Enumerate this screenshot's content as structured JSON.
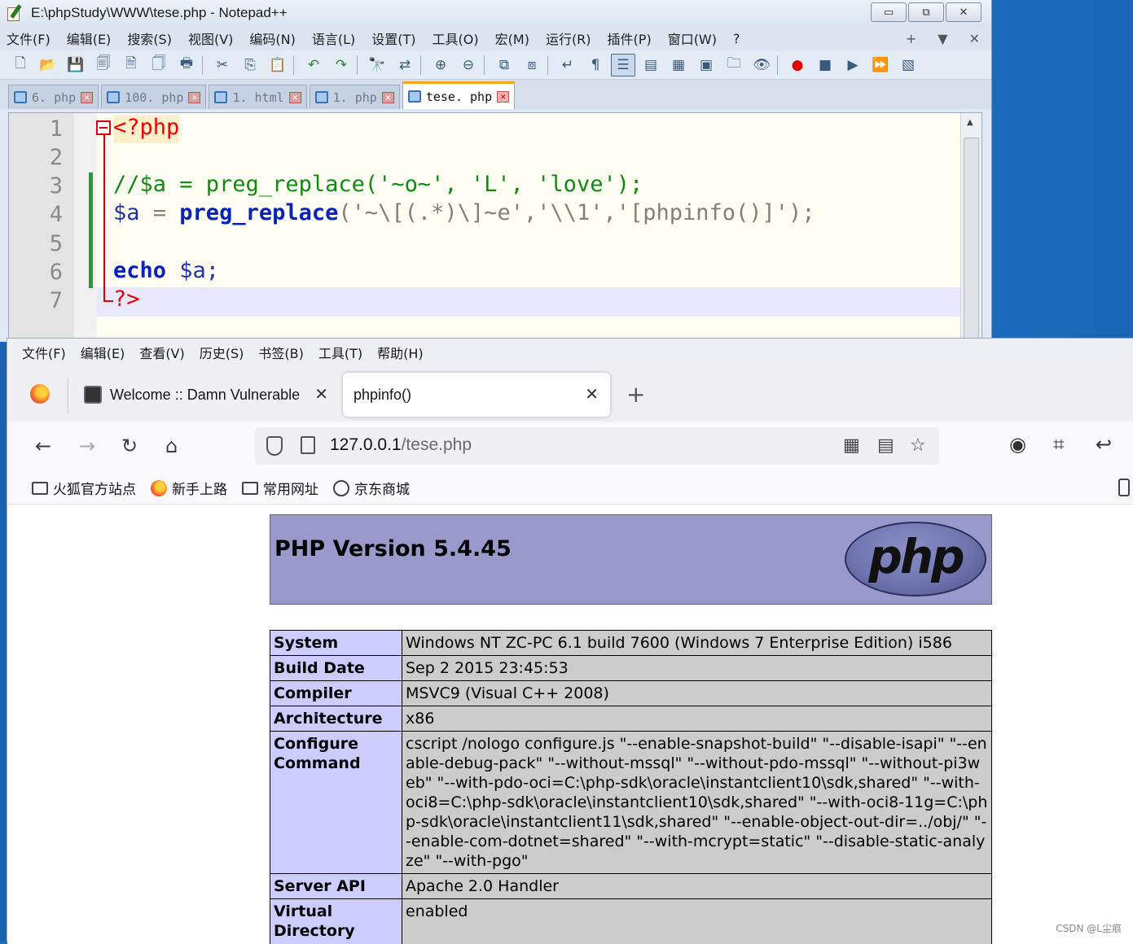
{
  "npp": {
    "title": "E:\\phpStudy\\WWW\\tese.php - Notepad++",
    "window_buttons": [
      "▭",
      "⧉",
      "✕"
    ],
    "menu": [
      "文件(F)",
      "编辑(E)",
      "搜索(S)",
      "视图(V)",
      "编码(N)",
      "语言(L)",
      "设置(T)",
      "工具(O)",
      "宏(M)",
      "运行(R)",
      "插件(P)",
      "窗口(W)",
      "?"
    ],
    "menu_right": [
      "+",
      "▼",
      "✕"
    ],
    "tabs": [
      "6. php",
      "100. php",
      "1. html",
      "1. php",
      "tese. php"
    ],
    "active_tab": "tese. php",
    "line_numbers": [
      "1",
      "2",
      "3",
      "4",
      "5",
      "6",
      "7"
    ],
    "code": {
      "l1": "<?php",
      "l3": "//$a = preg_replace('~o~', 'L', 'love');",
      "l4_var": "$a",
      "l4_eq": " = ",
      "l4_fn": "preg_replace",
      "l4_args": "('~\\[(.*)\\]~e','\\\\1','[phpinfo()]');",
      "l6_kw": "echo",
      "l6_rest": " $a;",
      "l7": "?>"
    }
  },
  "firefox": {
    "menu": [
      "文件(F)",
      "编辑(E)",
      "查看(V)",
      "历史(S)",
      "书签(B)",
      "工具(T)",
      "帮助(H)"
    ],
    "tabs": [
      {
        "title": "Welcome :: Damn Vulnerable",
        "close": "✕"
      },
      {
        "title": "phpinfo()",
        "close": "✕"
      }
    ],
    "new_tab": "+",
    "url_host": "127.0.0.1",
    "url_path": "/tese.php",
    "bookmarks": [
      "火狐官方站点",
      "新手上路",
      "常用网址",
      "京东商城"
    ]
  },
  "phpinfo": {
    "version": "PHP Version 5.4.45",
    "logo_text": "php",
    "rows": [
      {
        "k": "System",
        "v": "Windows NT ZC-PC 6.1 build 7600 (Windows 7 Enterprise Edition) i586"
      },
      {
        "k": "Build Date",
        "v": "Sep 2 2015 23:45:53"
      },
      {
        "k": "Compiler",
        "v": "MSVC9 (Visual C++ 2008)"
      },
      {
        "k": "Architecture",
        "v": "x86"
      },
      {
        "k": "Configure Command",
        "v": "cscript /nologo configure.js \"--enable-snapshot-build\" \"--disable-isapi\" \"--enable-debug-pack\" \"--without-mssql\" \"--without-pdo-mssql\" \"--without-pi3web\" \"--with-pdo-oci=C:\\php-sdk\\oracle\\instantclient10\\sdk,shared\" \"--with-oci8=C:\\php-sdk\\oracle\\instantclient10\\sdk,shared\" \"--with-oci8-11g=C:\\php-sdk\\oracle\\instantclient11\\sdk,shared\" \"--enable-object-out-dir=../obj/\" \"--enable-com-dotnet=shared\" \"--with-mcrypt=static\" \"--disable-static-analyze\" \"--with-pgo\""
      },
      {
        "k": "Server API",
        "v": "Apache 2.0 Handler"
      },
      {
        "k": "Virtual Directory Support",
        "v": "enabled"
      }
    ]
  },
  "watermark": "CSDN @L尘痕",
  "colors": {
    "php_header": "#9999cc",
    "php_key": "#ccccff",
    "php_value": "#cccccc",
    "npp_bg": "#fffef3"
  }
}
